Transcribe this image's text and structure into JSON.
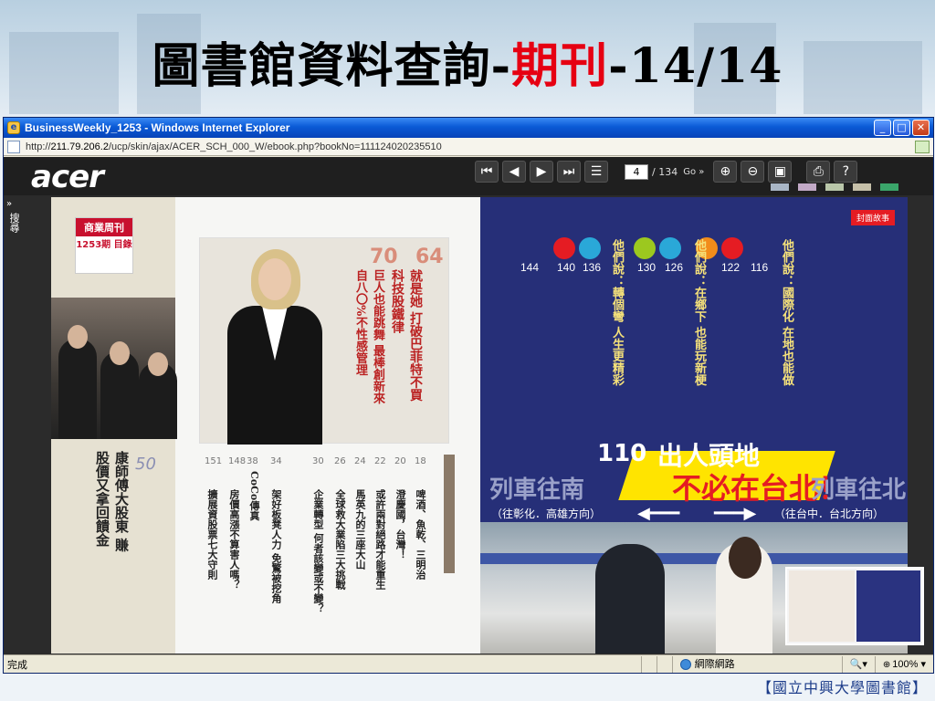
{
  "slide": {
    "title_part1": "圖書館資料查詢-",
    "title_highlight": "期刊",
    "title_part2": "-14/14",
    "highlight_color": "#e60012",
    "footer": "【國立中興大學圖書館】"
  },
  "window": {
    "title": "BusinessWeekly_1253 - Windows Internet Explorer",
    "url_prefix": "http://",
    "url_host": "211.79.206.2",
    "url_path": "/ucp/skin/ajax/ACER_SCH_000_W/ebook.php?bookNo=111124020235510",
    "controls": {
      "minimize": "_",
      "maximize": "□",
      "close": "✕"
    }
  },
  "viewer": {
    "logo": "acer",
    "side_tab": {
      "arrows": "»",
      "label": "搜尋"
    },
    "toolbar": {
      "first_icon": "first-page-icon",
      "prev_icon": "prev-page-icon",
      "next_icon": "next-page-icon",
      "last_icon": "last-page-icon",
      "thumbnails_icon": "thumbnails-icon",
      "page_current": "4",
      "page_total": "/ 134",
      "go_label": "Go »",
      "zoom_in_icon": "zoom-in-icon",
      "zoom_out_icon": "zoom-out-icon",
      "fit_icon": "fit-icon",
      "print_icon": "print-icon",
      "help_icon": "help-icon"
    },
    "swatch_colors": [
      "#a9b6c6",
      "#c2a9c6",
      "#b9c6a9",
      "#c6c0a9",
      "#3aa56a"
    ]
  },
  "magazine": {
    "left": {
      "brand": "商業周刊",
      "issue": "1253期 目錄",
      "feature_num": "50",
      "feature_title": "康師傅大股東 賺股價又拿回饋金",
      "story_nums": [
        "70",
        "64"
      ],
      "story_title_1": "就是她 打破巴菲特不買科技股鐵律",
      "story_title_2": "巨人也能跳舞 最棒創新來自八〇%不性感管理",
      "toc_nums": [
        "151",
        "148",
        "38",
        "34",
        "30",
        "26",
        "24",
        "22",
        "20",
        "18"
      ],
      "toc_titles": [
        "擴展資股票七大守則",
        "房價高漲不算害人嗎？",
        "CoCo傳真",
        "架好板凳人力 免驚被挖角",
        "企業轉型 何者該變或不變？",
        "全球救大業陷三大挑戰",
        "馬英九的三座大山",
        "或許兩對絕路才能重生",
        "澄慶國，台灣！",
        "啤酒、魚乾、三明治"
      ]
    },
    "right": {
      "tab": "封面故事",
      "nums": [
        "144",
        "140",
        "136",
        "130",
        "126",
        "122",
        "116"
      ],
      "headers": [
        "他們說：轉個彎 人生更精彩",
        "他們說：在鄉下 也能玩新梗",
        "他們說：國際化 在地也能做"
      ],
      "banner_num": "110",
      "banner_line1": "出人頭地",
      "banner_line2": "不必在台北！",
      "banner_south": "列車往南",
      "banner_north": "列車往北",
      "banner_south_sub": "（往彰化．高雄方向）",
      "banner_north_sub": "（往台中．台北方向）"
    }
  },
  "statusbar": {
    "done": "完成",
    "zone": "網際網路",
    "zoom": "100%"
  }
}
